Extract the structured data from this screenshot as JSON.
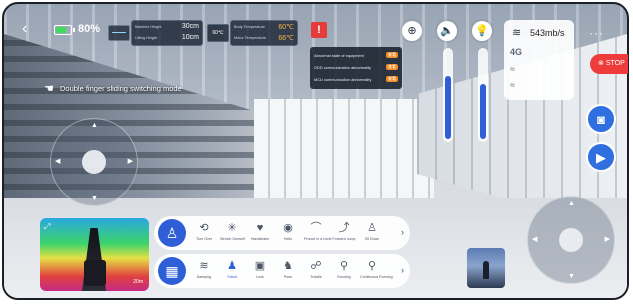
{
  "status": {
    "battery_level": 0.8,
    "battery_text": "80",
    "machine_height_label": "Machine Height",
    "machine_height_value": "30cm",
    "lifting_height_label": "Lifting Height",
    "lifting_height_value": "10cm",
    "temp_chip": "60℃",
    "body_temp_label": "Body Temperature",
    "body_temp_value": "60℃",
    "motor_temp_label": "Motor Temperature",
    "motor_temp_value": "66℃"
  },
  "alerts": [
    {
      "text": "Abnormal state of equipment",
      "badge": "查看"
    },
    {
      "text": "ODD communication abnormality",
      "badge": "查看"
    },
    {
      "text": "MCU communication abnormality",
      "badge": "查看"
    }
  ],
  "controls": {
    "joystick_target_icon": "crosshair-icon",
    "volume_icon": "speaker-icon",
    "light_icon": "lightbulb-icon",
    "volume_level": 0.72,
    "light_level": 0.62
  },
  "network": {
    "speed": "543mb/s",
    "cell_label": "4G"
  },
  "stop_label": "STOP",
  "hint": "Double finger sliding switching mode",
  "minimap": {
    "scale": "20m"
  },
  "actions_row1": [
    {
      "label": "Turn Over",
      "icon": "turnover-icon",
      "glyph": "⟲"
    },
    {
      "label": "Stretch Oneself",
      "icon": "stretch-icon",
      "glyph": "✳"
    },
    {
      "label": "Handshake",
      "icon": "handshake-icon",
      "glyph": "♥"
    },
    {
      "label": "Hello",
      "icon": "hello-icon",
      "glyph": "◉"
    },
    {
      "label": "Prance in a circle",
      "icon": "prance-icon",
      "glyph": "⌒"
    },
    {
      "label": "Forward Jump",
      "icon": "forward-jump-icon",
      "glyph": "⤴"
    },
    {
      "label": "Sit Down",
      "icon": "sit-icon",
      "glyph": "♙"
    }
  ],
  "actions_row2": [
    {
      "label": "Damping",
      "icon": "damping-icon",
      "glyph": "≋"
    },
    {
      "label": "Stand",
      "icon": "stand-icon",
      "glyph": "♟",
      "active": true
    },
    {
      "label": "Lock",
      "icon": "lock-icon",
      "glyph": "▣"
    },
    {
      "label": "Pose",
      "icon": "pose-icon",
      "glyph": "♞"
    },
    {
      "label": "Trotaile",
      "icon": "trot-icon",
      "glyph": "☍"
    },
    {
      "label": "Running",
      "icon": "running-icon",
      "glyph": "⚲"
    },
    {
      "label": "Continuous Running",
      "icon": "continuous-running-icon",
      "glyph": "⚲"
    }
  ]
}
